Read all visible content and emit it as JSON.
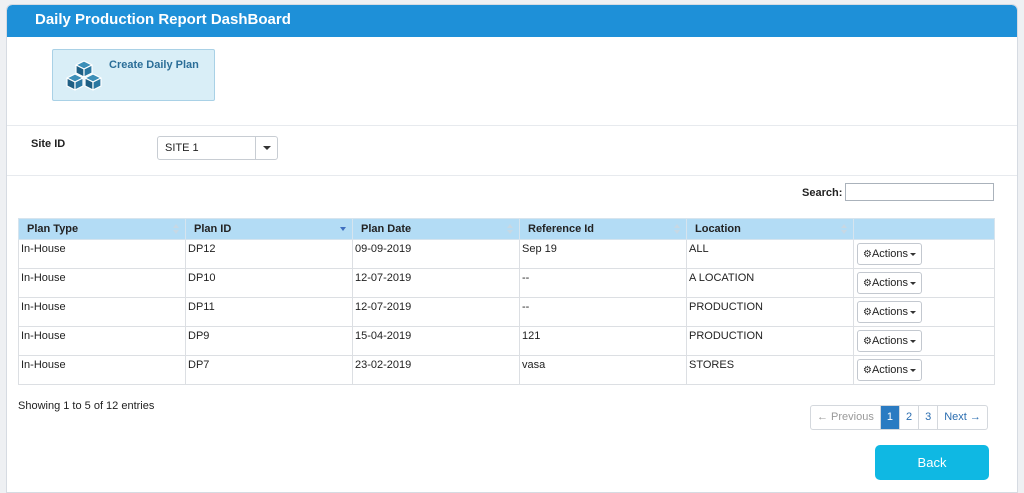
{
  "header": {
    "title": "Daily Production Report DashBoard"
  },
  "tile": {
    "label": "Create Daily Plan",
    "icon": "cubes-icon"
  },
  "site": {
    "label": "Site ID",
    "selected": "SITE 1"
  },
  "search": {
    "label": "Search:",
    "value": ""
  },
  "table": {
    "columns": [
      "Plan Type",
      "Plan ID",
      "Plan Date",
      "Reference Id",
      "Location",
      ""
    ],
    "rows": [
      {
        "type": "In-House",
        "id": "DP12",
        "date": "09-09-2019",
        "ref": "Sep 19",
        "location": "ALL",
        "action": "Actions"
      },
      {
        "type": "In-House",
        "id": "DP10",
        "date": "12-07-2019",
        "ref": "--",
        "location": "A LOCATION",
        "action": "Actions"
      },
      {
        "type": "In-House",
        "id": "DP11",
        "date": "12-07-2019",
        "ref": "--",
        "location": "PRODUCTION",
        "action": "Actions"
      },
      {
        "type": "In-House",
        "id": "DP9",
        "date": "15-04-2019",
        "ref": "121",
        "location": "PRODUCTION",
        "action": "Actions"
      },
      {
        "type": "In-House",
        "id": "DP7",
        "date": "23-02-2019",
        "ref": "vasa",
        "location": "STORES",
        "action": "Actions"
      }
    ]
  },
  "info": "Showing 1 to 5 of 12 entries",
  "pager": {
    "prev": "← Previous",
    "pages": [
      "1",
      "2",
      "3"
    ],
    "next": "Next →"
  },
  "back": {
    "label": "Back"
  },
  "colors": {
    "header": "#1e90d8",
    "tile": "#d9eef7",
    "table_head": "#b3dcf5",
    "back": "#0fb8e3",
    "page_active": "#2a7bc2"
  }
}
